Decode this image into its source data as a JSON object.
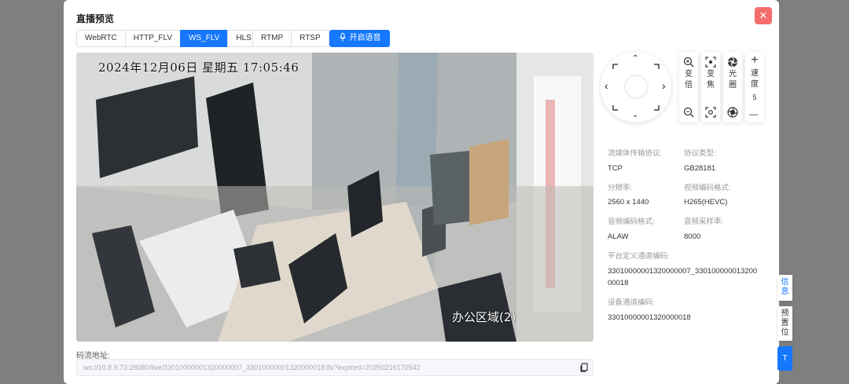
{
  "dialog": {
    "title": "直播预览",
    "close_label": "✕"
  },
  "protocols": {
    "group1": [
      "WebRTC",
      "HTTP_FLV",
      "WS_FLV",
      "HLS"
    ],
    "group2": [
      "RTMP",
      "RTSP"
    ],
    "active": "WS_FLV"
  },
  "voice_button": {
    "label": "开启语音",
    "icon": "microphone-icon"
  },
  "video": {
    "osd_datetime": "2024年12月06日  星期五  17:05:46",
    "osd_area": "办公区域(2)"
  },
  "stream_url": {
    "label": "码流地址:",
    "value": "ws://10.8.9.73:28080/live/33010000001320000007_33010000001320000018.flv?expired=20250216170542",
    "copy_icon": "copy-icon"
  },
  "ptz": {
    "up": "⌃",
    "down": "⌄",
    "left": "‹",
    "right": "›"
  },
  "lens": {
    "zoom": {
      "label": "变倍",
      "icon_top": "zoom-in-icon",
      "icon_bottom": "zoom-out-icon"
    },
    "focus": {
      "label": "变焦",
      "icon_top": "focus-near-icon",
      "icon_bottom": "focus-far-icon"
    },
    "iris": {
      "label": "光圈",
      "icon_top": "iris-open-icon",
      "icon_bottom": "iris-close-icon"
    },
    "speed": {
      "label": "速度",
      "value": "5",
      "plus": "+",
      "minus": "—"
    }
  },
  "info": {
    "protocol_key": "流媒体传输协议:",
    "protocol_value": "TCP",
    "type_key": "协议类型:",
    "type_value": "GB28181",
    "resolution_key": "分辨率:",
    "resolution_value": "2560 x 1440",
    "video_codec_key": "视频编码格式:",
    "video_codec_value": "H265(HEVC)",
    "audio_codec_key": "音频编码格式:",
    "audio_codec_value": "ALAW",
    "sample_rate_key": "音频采样率:",
    "sample_rate_value": "8000",
    "platform_channel_key": "平台定义通道编码:",
    "platform_channel_value_line1": "33010000001320000007_330100000013200",
    "platform_channel_value_line2": "00018",
    "device_channel_key": "设备通道编码:",
    "device_channel_value": "33010000001320000018"
  },
  "side_tabs": {
    "info": "信息",
    "preset": "预置位",
    "top": "T"
  },
  "colors": {
    "primary": "#1677ff",
    "danger": "#f56c6c"
  }
}
